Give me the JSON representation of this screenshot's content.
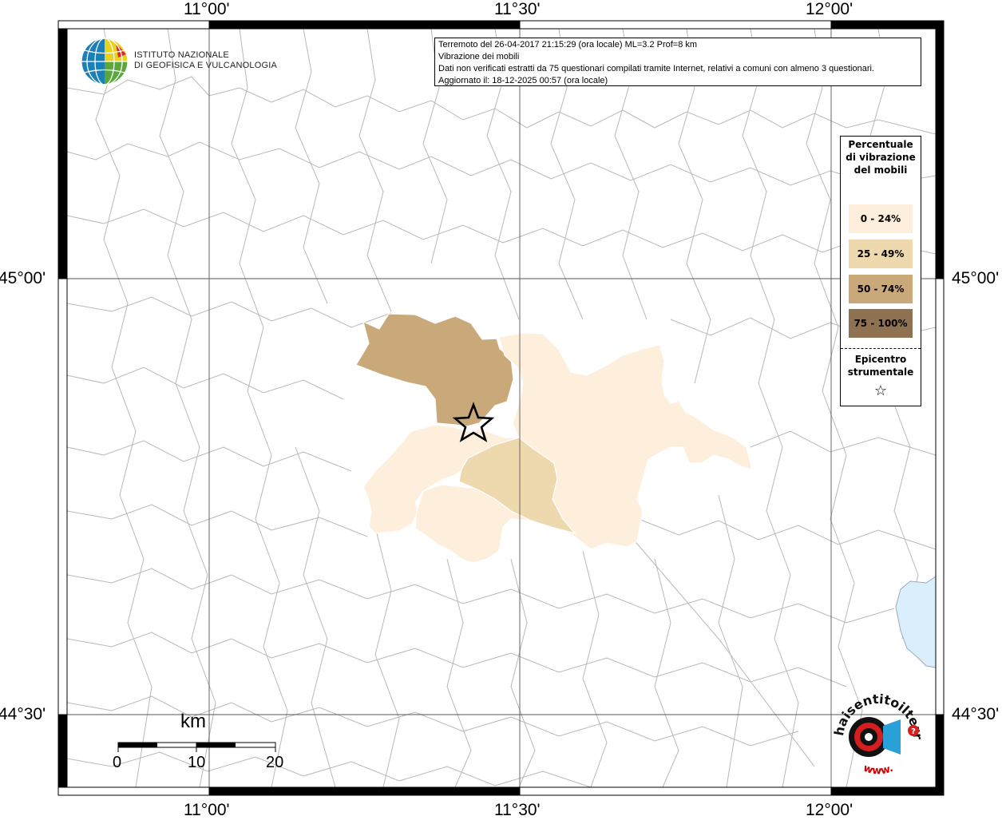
{
  "map": {
    "longitude_labels": [
      "11°00'",
      "11°30'",
      "12°00'"
    ],
    "latitude_labels": [
      "45°00'",
      "44°30'"
    ]
  },
  "info": {
    "line1": "Terremoto del 26-04-2017 21:15:29 (ora locale) ML=3.2 Prof=8 km",
    "line2": "Vibrazione dei mobili",
    "line3": "Dati non verificati estratti da 75 questionari compilati tramite Internet, relativi a comuni con almeno 3 questionari.",
    "line4": "Aggiornato il: 18-12-2025 00:57 (ora locale)"
  },
  "legend": {
    "title": "Percentuale di vibrazione del mobili",
    "classes": [
      {
        "label": "0 - 24%",
        "color": "#fdefdc"
      },
      {
        "label": "25 - 49%",
        "color": "#eed9ae"
      },
      {
        "label": "50 - 74%",
        "color": "#c9a87a"
      },
      {
        "label": "75 - 100%",
        "color": "#8e7252"
      }
    ],
    "epicenter_label": "Epicentro strumentale",
    "epicenter_symbol": "☆"
  },
  "logo": {
    "line1": "ISTITUTO NAZIONALE",
    "line2": "DI GEOFISICA E VULCANOLOGIA"
  },
  "scale": {
    "unit": "km",
    "ticks": [
      "0",
      "10",
      "20"
    ]
  },
  "badge": {
    "text": "haisentitoilterremoto.it",
    "url_text": "www."
  },
  "colors": {
    "boundary": "#b4b4b4",
    "grid": "#555555",
    "water": "#dbeefb",
    "frame": "#000000"
  }
}
